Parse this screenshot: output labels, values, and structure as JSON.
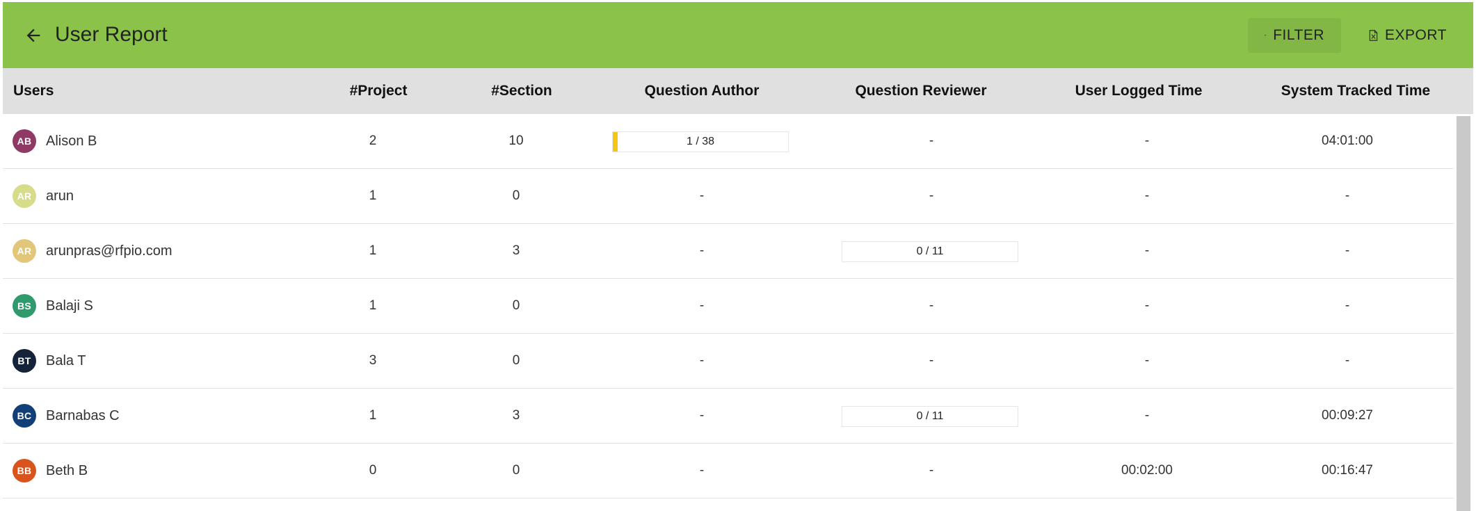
{
  "header": {
    "title": "User Report",
    "filter_label": "FILTER",
    "export_label": "EXPORT",
    "bg_color": "#8bc34a"
  },
  "columns": [
    "Users",
    "#Project",
    "#Section",
    "Question Author",
    "Question Reviewer",
    "User Logged Time",
    "System Tracked Time"
  ],
  "rows": [
    {
      "initials": "AB",
      "avatar_color": "#8e3a65",
      "name": "Alison B",
      "project": "2",
      "section": "10",
      "author": {
        "type": "progress",
        "label": "1 / 38",
        "fraction": 0.026
      },
      "reviewer": {
        "type": "text",
        "label": "-"
      },
      "logged": "-",
      "tracked": "04:01:00"
    },
    {
      "initials": "AR",
      "avatar_color": "#d6dc8a",
      "name": "arun",
      "project": "1",
      "section": "0",
      "author": {
        "type": "text",
        "label": "-"
      },
      "reviewer": {
        "type": "text",
        "label": "-"
      },
      "logged": "-",
      "tracked": "-"
    },
    {
      "initials": "AR",
      "avatar_color": "#e2c67a",
      "name": "arunpras@rfpio.com",
      "project": "1",
      "section": "3",
      "author": {
        "type": "text",
        "label": "-"
      },
      "reviewer": {
        "type": "progress",
        "label": "0 / 11",
        "fraction": 0
      },
      "logged": "-",
      "tracked": "-"
    },
    {
      "initials": "BS",
      "avatar_color": "#2e9a6e",
      "name": "Balaji S",
      "project": "1",
      "section": "0",
      "author": {
        "type": "text",
        "label": "-"
      },
      "reviewer": {
        "type": "text",
        "label": "-"
      },
      "logged": "-",
      "tracked": "-"
    },
    {
      "initials": "BT",
      "avatar_color": "#14233a",
      "name": "Bala T",
      "project": "3",
      "section": "0",
      "author": {
        "type": "text",
        "label": "-"
      },
      "reviewer": {
        "type": "text",
        "label": "-"
      },
      "logged": "-",
      "tracked": "-"
    },
    {
      "initials": "BC",
      "avatar_color": "#123f78",
      "name": "Barnabas C",
      "project": "1",
      "section": "3",
      "author": {
        "type": "text",
        "label": "-"
      },
      "reviewer": {
        "type": "progress",
        "label": "0 / 11",
        "fraction": 0
      },
      "logged": "-",
      "tracked": "00:09:27"
    },
    {
      "initials": "BB",
      "avatar_color": "#d9541c",
      "name": "Beth B",
      "project": "0",
      "section": "0",
      "author": {
        "type": "text",
        "label": "-"
      },
      "reviewer": {
        "type": "text",
        "label": "-"
      },
      "logged": "00:02:00",
      "tracked": "00:16:47"
    }
  ]
}
